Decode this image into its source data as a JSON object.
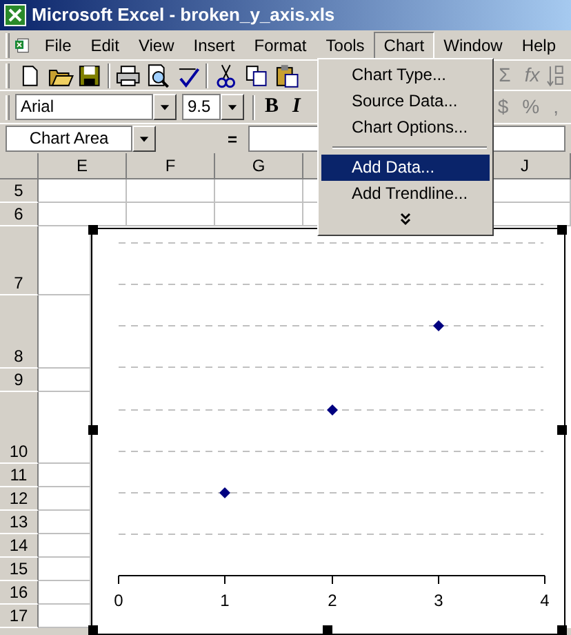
{
  "window": {
    "title": "Microsoft Excel - broken_y_axis.xls"
  },
  "menu_bar": [
    {
      "label": "File",
      "selected": false
    },
    {
      "label": "Edit",
      "selected": false
    },
    {
      "label": "View",
      "selected": false
    },
    {
      "label": "Insert",
      "selected": false
    },
    {
      "label": "Format",
      "selected": false
    },
    {
      "label": "Tools",
      "selected": false
    },
    {
      "label": "Chart",
      "selected": true
    },
    {
      "label": "Window",
      "selected": false
    },
    {
      "label": "Help",
      "selected": false
    }
  ],
  "chart_menu": [
    {
      "kind": "item",
      "label": "Chart Type...",
      "selected": false
    },
    {
      "kind": "item",
      "label": "Source Data...",
      "selected": false
    },
    {
      "kind": "item",
      "label": "Chart Options...",
      "selected": false
    },
    {
      "kind": "separator"
    },
    {
      "kind": "item",
      "label": "Add Data...",
      "selected": true
    },
    {
      "kind": "item",
      "label": "Add Trendline...",
      "selected": false
    },
    {
      "kind": "expand"
    }
  ],
  "standard_toolbar": {
    "trailing": [
      "Σ",
      "fx"
    ]
  },
  "formatting_toolbar": {
    "font": "Arial",
    "size": "9.5",
    "bold": "B",
    "italic": "I",
    "trailing": [
      "$",
      "%",
      ","
    ]
  },
  "name_box": "Chart Area",
  "formula_bar": {
    "label": "="
  },
  "sheet": {
    "columns": [
      "E",
      "F",
      "G",
      "J"
    ],
    "rows": [
      "5",
      "6",
      "7",
      "8",
      "9",
      "10",
      "11",
      "12",
      "13",
      "14",
      "15",
      "16",
      "17"
    ]
  },
  "chart": {
    "selected": true,
    "x_tick_labels": [
      "0",
      "1",
      "2",
      "3",
      "4"
    ]
  }
}
